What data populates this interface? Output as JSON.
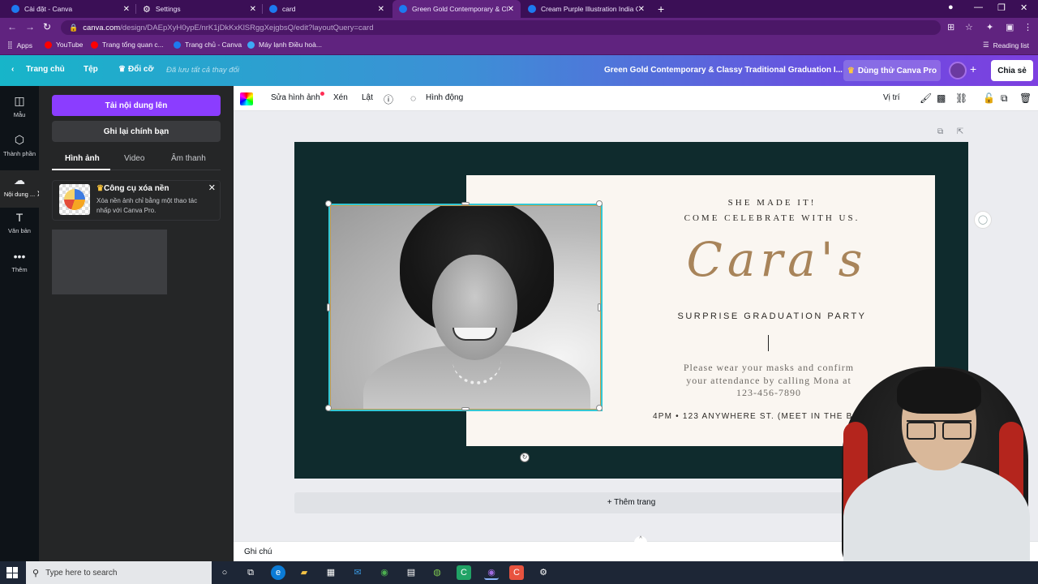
{
  "browser": {
    "tabs": [
      {
        "label": "Cài đặt - Canva",
        "icon": "canva-favicon"
      },
      {
        "label": "Settings",
        "icon": "gear-favicon"
      },
      {
        "label": "card",
        "icon": "canva-favicon"
      },
      {
        "label": "Green Gold Contemporary & Cla",
        "icon": "canva-favicon",
        "active": true
      },
      {
        "label": "Cream Purple Illustration India G",
        "icon": "canva-favicon"
      }
    ],
    "new_tab_symbol": "+",
    "url_host": "canva.com",
    "url_path": "/design/DAEpXyH0ypE/nrK1jDkKxKlSRggXejgbsQ/edit?layoutQuery=card",
    "bookmarks": [
      {
        "label": "Apps",
        "color": "#ffffff"
      },
      {
        "label": "YouTube",
        "color": "#ff0000"
      },
      {
        "label": "Trang tổng quan c...",
        "color": "#ff0000"
      },
      {
        "label": "Trang chủ - Canva",
        "color": "#1d7af0"
      },
      {
        "label": "Máy lạnh Điều hoà...",
        "color": "#3da9f5"
      }
    ],
    "reading_list": "Reading list"
  },
  "canva_header": {
    "home": "Trang chủ",
    "file": "Tệp",
    "resize": "Đổi cỡ",
    "saved_note": "Đã lưu tất cả thay đổi",
    "doc_title": "Green Gold Contemporary & Classy Traditional Graduation I...",
    "try_pro": "Dùng thử Canva Pro",
    "share": "Chia sẻ"
  },
  "rail": {
    "items": [
      {
        "label": "Mẫu",
        "icon": "template-icon"
      },
      {
        "label": "Thành phần",
        "icon": "elements-icon"
      },
      {
        "label": "Nội dung ...",
        "icon": "upload-cloud-icon",
        "active": true
      },
      {
        "label": "Văn bản",
        "icon": "text-icon"
      },
      {
        "label": "Thêm",
        "icon": "more-icon"
      }
    ]
  },
  "panel": {
    "upload_btn": "Tải nội dung lên",
    "record_btn": "Ghi lại chính bạn",
    "tabs": [
      "Hình ảnh",
      "Video",
      "Âm thanh"
    ],
    "promo_title": "Công cụ xóa nền",
    "promo_desc": "Xóa nền ảnh chỉ bằng một thao tác nhấp với Canva Pro."
  },
  "toolbar": {
    "edit_image": "Sửa hình ảnh",
    "crop": "Xén",
    "flip": "Lật",
    "animate": "Hình động",
    "position": "Vị trí"
  },
  "design": {
    "headline1": "SHE MADE IT!",
    "headline2": "COME CELEBRATE WITH US.",
    "script_name": "Cara's",
    "party": "SURPRISE  GRADUATION PARTY",
    "body": "Please wear your masks and confirm your attendance by calling Mona at 123-456-7890",
    "address": "4PM • 123 ANYWHERE ST. (MEET IN THE BACKYA",
    "colors": {
      "background": "#0f2b2d",
      "card": "#faf6f1",
      "gold": "#c99b4d",
      "script": "#a8845a"
    }
  },
  "canvas": {
    "add_page": "+ Thêm trang",
    "notes": "Ghi chú"
  },
  "taskbar": {
    "search_placeholder": "Type here to search"
  }
}
